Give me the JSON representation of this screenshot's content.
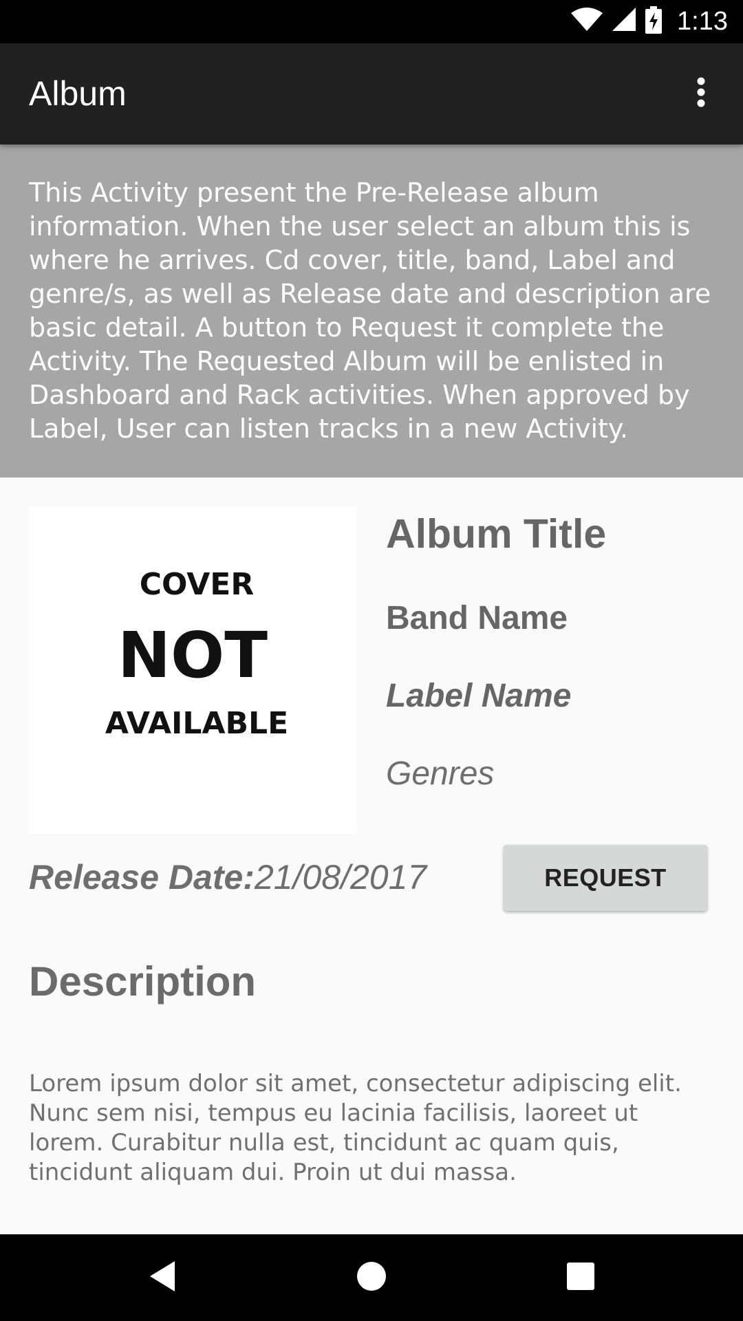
{
  "status_bar": {
    "time": "1:13",
    "icons": [
      "wifi-icon",
      "signal-icon",
      "battery-charging-icon"
    ]
  },
  "toolbar": {
    "title": "Album",
    "menu_icon": "overflow-menu-icon"
  },
  "info_panel": {
    "text": "This Activity present the Pre-Release album information. When the user select an album this is where he arrives. Cd cover, title, band, Label and genre/s, as well as Release date and description are basic detail. A button to Request it complete the Activity. The Requested Album will be enlisted in Dashboard and Rack activities. When approved by Label, User can listen tracks in a new Activity."
  },
  "cover": {
    "line1": "COVER",
    "line2": "NOT",
    "line3": "AVAILABLE"
  },
  "album": {
    "title": "Album Title",
    "band": "Band Name",
    "label": "Label Name",
    "genres": "Genres",
    "release_label": "Release Date:",
    "release_date": "21/08/2017"
  },
  "actions": {
    "request_label": "REQUEST"
  },
  "description": {
    "heading": "Description",
    "body": "Lorem ipsum dolor sit amet, consectetur adipiscing elit. Nunc sem nisi, tempus eu lacinia facilisis, laoreet ut lorem. Curabitur nulla est, tincidunt ac quam quis, tincidunt aliquam dui. Proin ut dui massa."
  },
  "nav_bar": {
    "icons": [
      "back-icon",
      "home-icon",
      "recents-icon"
    ]
  },
  "colors": {
    "toolbar": "#212121",
    "info_panel": "#a6a6a6",
    "background": "#fafafa",
    "button": "#d6d7d7",
    "text_muted": "#666666"
  }
}
